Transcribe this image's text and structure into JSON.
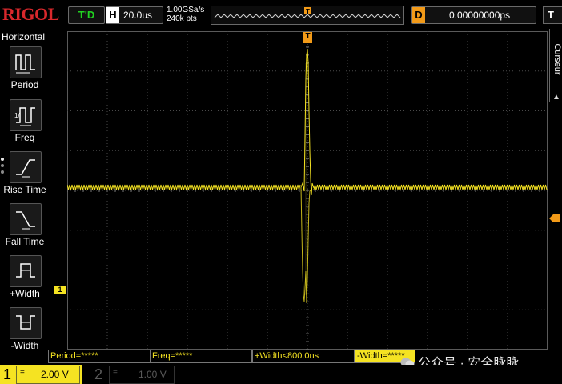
{
  "brand": "RIGOL",
  "header": {
    "trigger_status": "T'D",
    "horizontal_letter": "H",
    "timebase": "20.0us",
    "sample_rate": "1.00GSa/s",
    "memory_depth": "240k pts",
    "delay_letter": "D",
    "delay_value": "0.00000000ps",
    "trigger_letter": "T"
  },
  "left_menu": {
    "title": "Horizontal",
    "items": [
      {
        "label": "Period",
        "icon": "period-icon"
      },
      {
        "label": "Freq",
        "icon": "freq-icon"
      },
      {
        "label": "Rise Time",
        "icon": "rise-time-icon"
      },
      {
        "label": "Fall Time",
        "icon": "fall-time-icon"
      },
      {
        "label": "+Width",
        "icon": "positive-width-icon"
      },
      {
        "label": "-Width",
        "icon": "negative-width-icon"
      }
    ]
  },
  "right_tab": {
    "label": "Curseur"
  },
  "markers": {
    "trigger_top": "T",
    "channel1": "1"
  },
  "measurements": [
    {
      "label": "Period=*****"
    },
    {
      "label": "Freq=*****"
    },
    {
      "label": "+Width<800.0ns"
    },
    {
      "label": "-Width=*****"
    }
  ],
  "channels": [
    {
      "number": "1",
      "coupling": "=",
      "scale": "2.00 V",
      "active": true
    },
    {
      "number": "2",
      "coupling": "=",
      "scale": "1.00 V",
      "active": false
    }
  ],
  "watermark": "公众号 · 安全脉脉",
  "colors": {
    "ch1": "#f5e322",
    "trigger": "#f29a18",
    "brand": "#d8282c",
    "status": "#21d221"
  }
}
